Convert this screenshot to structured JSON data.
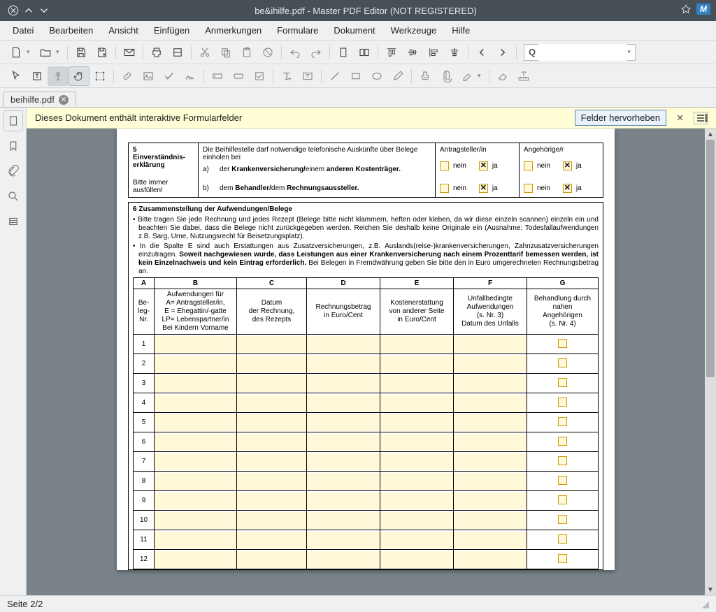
{
  "titlebar": {
    "title": "be&ihilfe.pdf - Master PDF Editor (NOT REGISTERED)"
  },
  "menu": [
    "Datei",
    "Bearbeiten",
    "Ansicht",
    "Einfügen",
    "Anmerkungen",
    "Formulare",
    "Dokument",
    "Werkzeuge",
    "Hilfe"
  ],
  "tab": {
    "label": "beihilfe.pdf"
  },
  "infobar": {
    "msg": "Dieses Dokument enthält interaktive Formularfelder",
    "btn": "Felder hervorheben"
  },
  "search": {
    "icon": "Q",
    "placeholder": ""
  },
  "status": {
    "page": "Seite 2/2"
  },
  "form": {
    "sec5": {
      "num": "5",
      "title": "Einverständnis-\nerklärung",
      "footer": "Bitte immer ausfüllen!",
      "intro": "Die Beihilfestelle darf notwendige telefonische Auskünfte über Belege einholen bei",
      "a": "a)",
      "a_text_pre": "der ",
      "a_text_b1": "Krankenversicherung/",
      "a_text_mid": "einem ",
      "a_text_b2": "anderen Kostenträger.",
      "b": "b)",
      "b_text_pre": "dem ",
      "b_text_b1": "Behandler/",
      "b_text_mid": "dem ",
      "b_text_b2": "Rechnungsaussteller.",
      "col3": "Antragsteller/in",
      "col4": "Angehörige/r",
      "nein": "nein",
      "ja": "ja"
    },
    "sec6": {
      "title": "6  Zusammenstellung der Aufwendungen/Belege",
      "li1": "Bitte tragen Sie jede Rechnung und jedes Rezept (Belege bitte nicht klammern, heften oder kleben, da wir diese einzeln scannen) einzeln ein und beachten Sie dabei, dass die Belege nicht zurückgegeben werden. Reichen Sie deshalb keine Originale ein (Ausnahme: Todesfallaufwendungen z.B. Sarg, Urne, Nutzungsrecht für Beisetzungsplatz).",
      "li2_pre": "In die Spalte E sind auch Erstattungen aus Zusatzversicherungen, z.B. Auslands(reise-)krankenversicherungen, Zahnzusatzversicherungen einzutragen. ",
      "li2_b": "Soweit nachgewiesen wurde, dass Leistungen aus einer Krankenversicherung nach einem Prozenttarif bemessen werden, ist kein Einzelnachweis und kein Eintrag erforderlich.",
      "li2_post": " Bei Belegen in Fremdwährung geben Sie bitte den in Euro umgerechneten Rechnungsbetrag an."
    },
    "cols": {
      "A": "A",
      "B": "B",
      "C": "C",
      "D": "D",
      "E": "E",
      "F": "F",
      "G": "G",
      "A_sub": "Be-\nleg-\nNr.",
      "B_sub": "Aufwendungen für\nA= Antragsteller/in,\nE = Ehegattin/-gatte\nLP= Lebenspartner/in\nBei Kindern Vorname",
      "C_sub": "Datum\nder Rechnung,\ndes Rezepts",
      "D_sub": "Rechnungsbetrag\nin Euro/Cent",
      "E_sub": "Kostenerstattung\nvon anderer Seite\nin Euro/Cent",
      "F_sub": "Unfallbedingte\nAufwendungen\n(s. Nr. 3)\nDatum des Unfalls",
      "G_sub": "Behandlung durch\nnahen\nAngehörigen\n(s. Nr. 4)"
    },
    "rows": [
      1,
      2,
      3,
      4,
      5,
      6,
      7,
      8,
      9,
      10,
      11,
      12
    ]
  }
}
